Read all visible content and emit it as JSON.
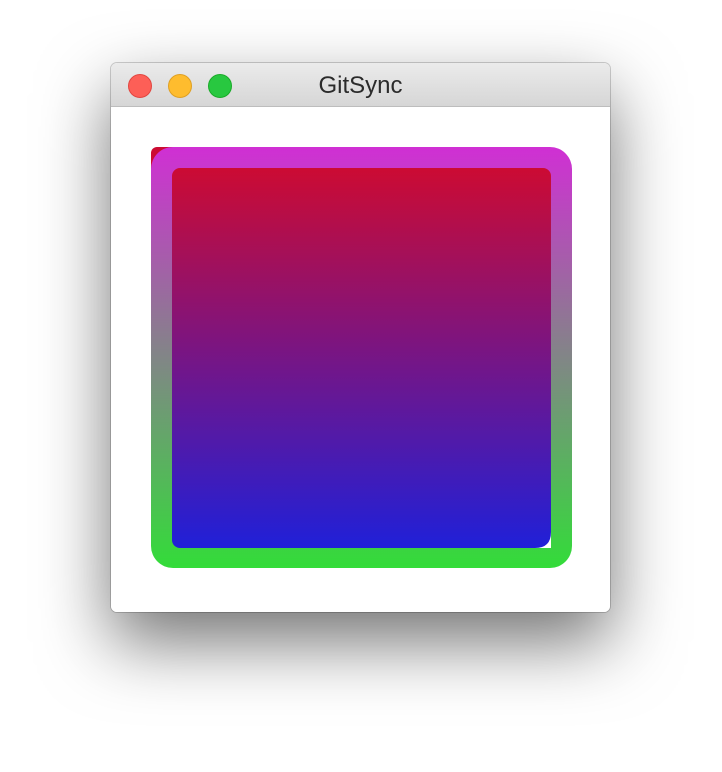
{
  "window": {
    "title": "GitSync",
    "controls": {
      "close": "close",
      "minimize": "minimize",
      "zoom": "zoom"
    }
  },
  "graphic": {
    "outer_gradient": [
      "#d02fd4",
      "#33dc39"
    ],
    "inner_gradient": [
      "#cc0b33",
      "#2020d8"
    ],
    "corner_accent_color": "#cc0b33"
  }
}
